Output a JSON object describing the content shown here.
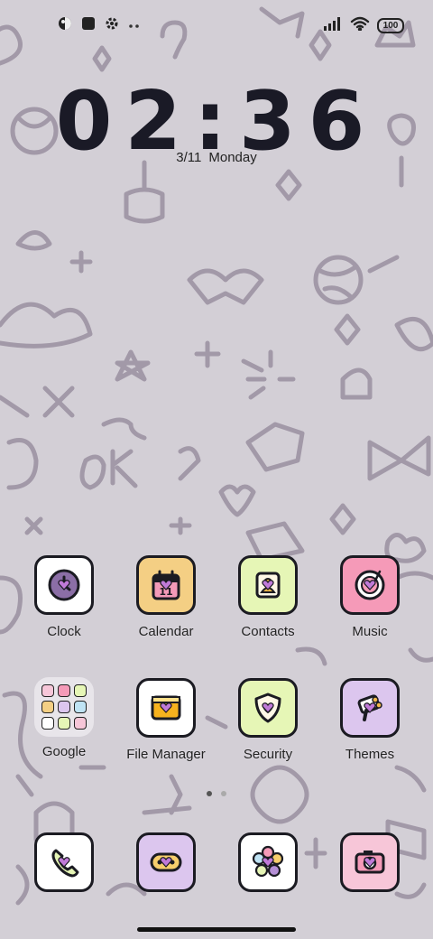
{
  "status_bar": {
    "battery_level": "100",
    "icons": [
      "theme-icon",
      "square-app-icon",
      "settings-gear-icon",
      "more-dots-icon",
      "signal-icon",
      "wifi-icon",
      "battery-icon"
    ]
  },
  "lockclock": {
    "time": "02:36",
    "date": "3/11",
    "weekday": "Monday"
  },
  "apps_row1": [
    {
      "label": "Clock",
      "color": "#ffffff"
    },
    {
      "label": "Calendar",
      "color": "#f4cf84"
    },
    {
      "label": "Contacts",
      "color": "#e6f6b6"
    },
    {
      "label": "Music",
      "color": "#f59ab8"
    }
  ],
  "apps_row2": [
    {
      "label": "Google",
      "color": "#e8e5ea"
    },
    {
      "label": "File Manager",
      "color": "#ffffff"
    },
    {
      "label": "Security",
      "color": "#e6f6b6"
    },
    {
      "label": "Themes",
      "color": "#dcc6ee"
    }
  ],
  "dock": [
    {
      "name": "Phone",
      "color": "#ffffff"
    },
    {
      "name": "Messages",
      "color": "#dcc6ee"
    },
    {
      "name": "Gallery",
      "color": "#ffffff"
    },
    {
      "name": "Camera",
      "color": "#f7c6d8"
    }
  ],
  "page_indicator": {
    "pages": 2,
    "current": 1
  },
  "colors": {
    "background": "#d3cfd6",
    "doodle": "#8f8596",
    "heart": "#c07ad8",
    "outline": "#1b1b22"
  }
}
